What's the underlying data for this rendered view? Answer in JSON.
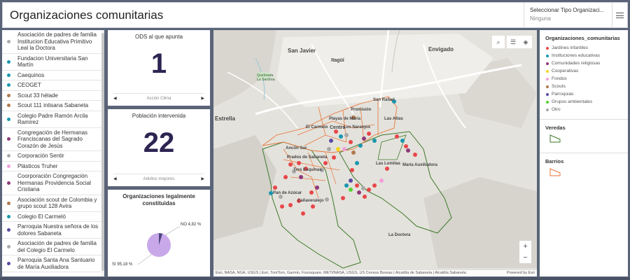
{
  "header": {
    "title": "Organizaciones comunitarias",
    "selector_label": "Seleccionar Tipo Organizaci...",
    "selector_value": "Ninguna"
  },
  "org_list": [
    {
      "name": "Asociación de padres de familia Institucion Educativa Primitivo Leal la Doctora",
      "color": "#a9a9a9"
    },
    {
      "name": "Fundacion Universitaria San Martín",
      "color": "#1a97b0"
    },
    {
      "name": "Caequinos",
      "color": "#1a97b0"
    },
    {
      "name": "CEOGET",
      "color": "#1a97b0"
    },
    {
      "name": "Scout 33 hélade",
      "color": "#b07a4e"
    },
    {
      "name": "Scout 111 intisana Sabaneta",
      "color": "#b07a4e"
    },
    {
      "name": "Colegio Padre Ramón Arcila Ramírez",
      "color": "#1a97b0"
    },
    {
      "name": "Congregación de Hermanas Franciscanas del Sagrado Corazón de Jesús",
      "color": "#8e3a7a"
    },
    {
      "name": "Corporación Sentir",
      "color": "#a9a9a9"
    },
    {
      "name": "Plásticos Truher",
      "color": "#f2a0d8"
    },
    {
      "name": "Coorporación Congregación Hermanas Providencia Social Cristiana",
      "color": "#8e3a7a"
    },
    {
      "name": "Asociación scout de Colombia y grupo scout 128 Avira",
      "color": "#b07a4e"
    },
    {
      "name": "Colegio El Carmeló",
      "color": "#1a97b0"
    },
    {
      "name": "Parroquia Nuestra señora de los dolores Sabaneta",
      "color": "#5b4aa3"
    },
    {
      "name": "Asociación de padres de familia del Colegio El Carmelo",
      "color": "#a9a9a9"
    },
    {
      "name": "Parroquia Santa Ana Santuario de María Auxiliadora",
      "color": "#5b4aa3"
    }
  ],
  "card_ods": {
    "title": "ODS al que apunta",
    "value": "1",
    "footer": "Acción Clima"
  },
  "card_pop": {
    "title": "Población intervenida",
    "value": "22",
    "footer": "Adultos mayores"
  },
  "card_legal": {
    "title": "Organizaciones legalmente constituidas",
    "label_no": "NO 4,82 %",
    "label_si": "SI 95,18 %",
    "si_fraction": 0.9518,
    "si_color": "#c9a8ea",
    "no_color": "#4d4580"
  },
  "map": {
    "labels": {
      "san_javier": "San Javier",
      "envigado": "Envigado",
      "itagui": "Itagüí",
      "estrella": "Estrella",
      "quebrada": "Quebrada La Sardina",
      "san_rafael": "San Rafael",
      "promision": "Promisión",
      "playas": "Playas de María",
      "las_atas": "Las Attas",
      "el_carmelo": "El Carmelo",
      "centro": "Centro",
      "naranjos": "Los Naranjos",
      "ancon": "Ancón Sur",
      "prados": "Prados de Sabaneta",
      "lomitas": "Las Lomitas",
      "maria_aux": "María Auxiliadora",
      "tres_esq": "Tres Esquinas",
      "pan_azucar": "Pan de Azúcar",
      "canaveralejo": "Cañaveralejo",
      "la_doctora": "La Doctora"
    },
    "attribution": "Esri, NASA, NGA, USGS | Esri, TomTom, Garmin, Foursquare, METI/NASA, USGS, US Census Bureau | Alcaldía de Sabaneta | Alcaldía Sabaneta",
    "powered": "Powered by Esri"
  },
  "legend": {
    "title": "Organizaciones_comunitarias",
    "items": [
      {
        "label": "Jardines infantiles",
        "color": "#e8474a"
      },
      {
        "label": "Instituciones educativas",
        "color": "#1a97b0"
      },
      {
        "label": "Comunidades religiosas",
        "color": "#8e3a7a"
      },
      {
        "label": "Cooperativas",
        "color": "#f5d520"
      },
      {
        "label": "Fondos",
        "color": "#f2a0d8"
      },
      {
        "label": "Scouts",
        "color": "#b07a4e"
      },
      {
        "label": "Parroquias",
        "color": "#5b4aa3"
      },
      {
        "label": "Grupos ambientales",
        "color": "#57d12f"
      },
      {
        "label": "Otro",
        "color": "#a9a9a9"
      }
    ],
    "veredas": "Veredas",
    "veredas_color": "#3c7a2a",
    "barrios": "Barrios",
    "barrios_color": "#e8763a"
  }
}
